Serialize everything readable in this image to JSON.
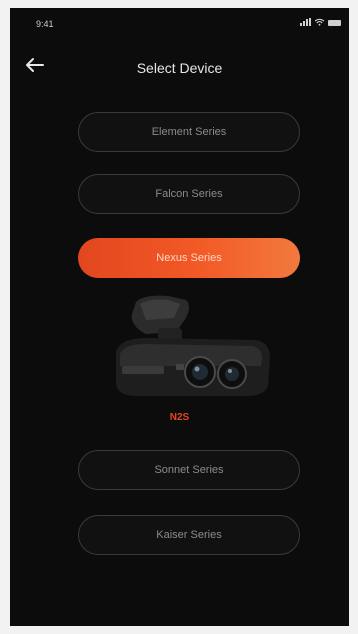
{
  "status_bar": {
    "time": "9:41"
  },
  "header": {
    "title": "Select Device"
  },
  "series": [
    {
      "label": "Element Series"
    },
    {
      "label": "Falcon Series"
    },
    {
      "label": "Nexus Series"
    },
    {
      "label": "Sonnet Series"
    },
    {
      "label": "Kaiser Series"
    }
  ],
  "selected_series_index": 2,
  "selected_model": "N2S",
  "icons": {
    "back": "arrow-left-icon",
    "signal": "signal-icon",
    "wifi": "wifi-icon",
    "battery": "battery-icon"
  },
  "colors": {
    "background": "#0c0c0c",
    "accent": "#e2461f",
    "button_border": "#3a3a3a",
    "text_muted": "#8b8b8b"
  }
}
